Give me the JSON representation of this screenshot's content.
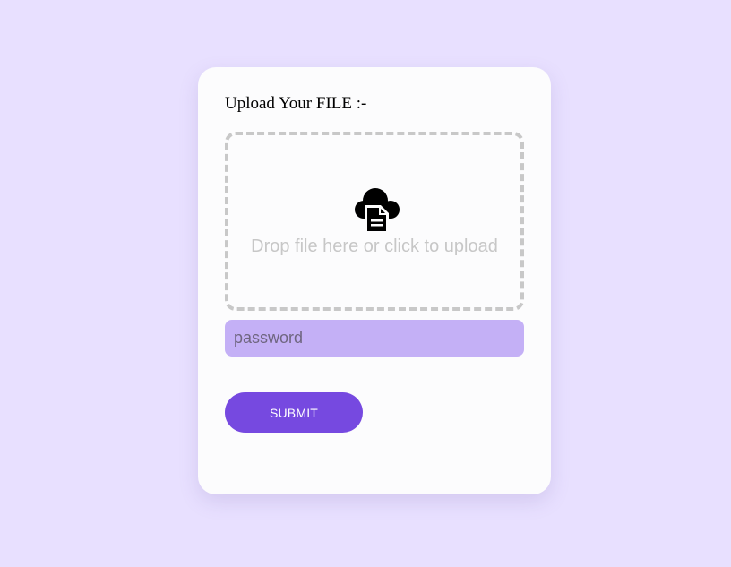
{
  "form": {
    "title": "Upload Your FILE :-",
    "dropzone": {
      "icon": "cloud-file-upload-icon",
      "text": "Drop file here or click to upload"
    },
    "password": {
      "value": "",
      "placeholder": "password"
    },
    "submit_label": "SUBMIT"
  },
  "colors": {
    "page_background": "#e8e0ff",
    "card_background": "#fcfcfd",
    "dropzone_border": "#c8c8c8",
    "drop_text": "#c7c7c7",
    "password_background": "#c4b0f6",
    "submit_background": "#7649e0",
    "submit_text": "#ffffff"
  }
}
